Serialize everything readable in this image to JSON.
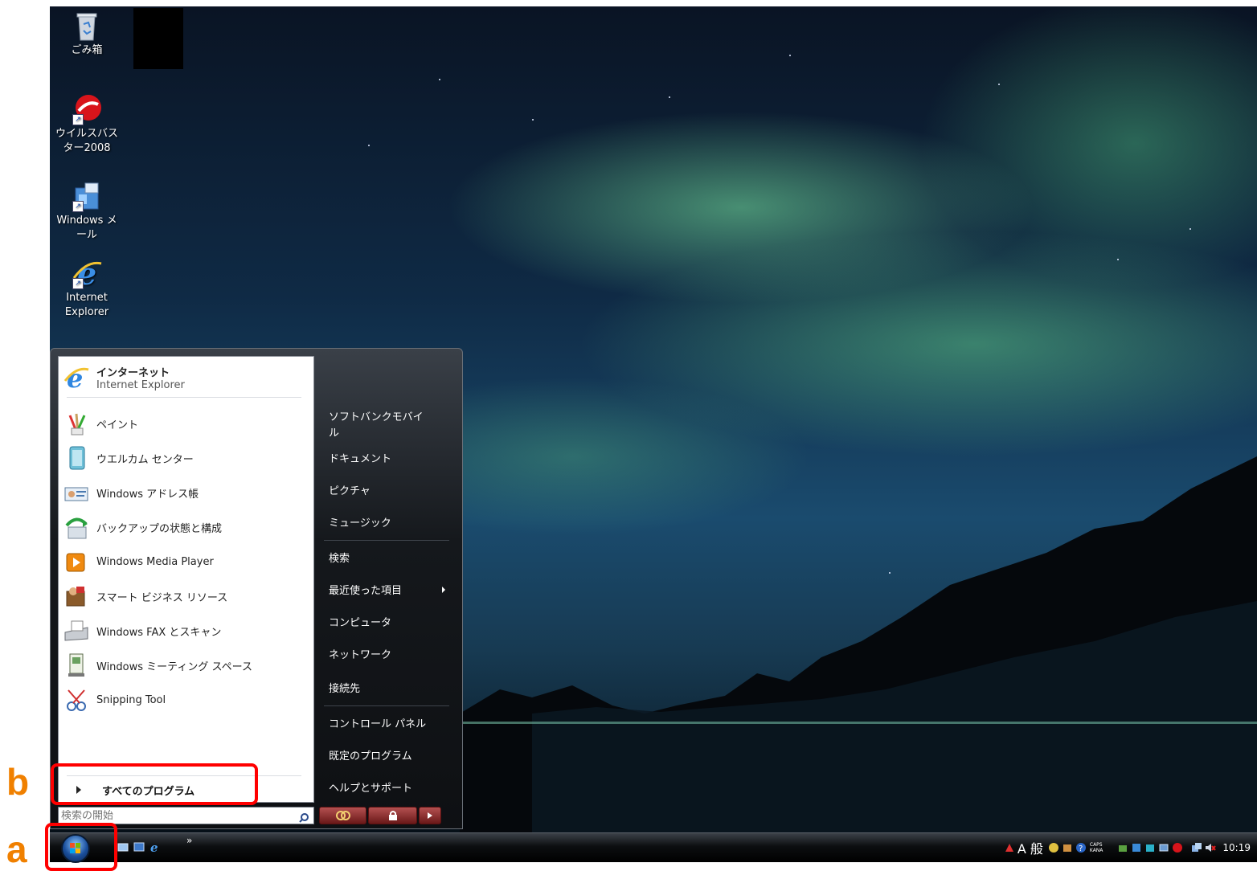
{
  "desktop": {
    "icons": [
      {
        "label": "ごみ箱",
        "icon": "recycle-bin-icon"
      },
      {
        "label": "ウイルスバス\nター2008",
        "icon": "virusbuster-icon"
      },
      {
        "label": "Windows メ\nール",
        "icon": "windows-mail-icon"
      },
      {
        "label": "Internet\nExplorer",
        "icon": "internet-explorer-icon"
      }
    ]
  },
  "start_menu": {
    "pinned": [
      {
        "title": "インターネット",
        "subtitle": "Internet Explorer",
        "icon": "internet-explorer-icon"
      }
    ],
    "recent": [
      {
        "label": "ペイント",
        "icon": "paint-icon"
      },
      {
        "label": "ウエルカム センター",
        "icon": "welcome-center-icon"
      },
      {
        "label": "Windows アドレス帳",
        "icon": "address-book-icon"
      },
      {
        "label": "バックアップの状態と構成",
        "icon": "backup-icon"
      },
      {
        "label": "Windows Media Player",
        "icon": "media-player-icon"
      },
      {
        "label": "スマート ビジネス リソース",
        "icon": "business-resource-icon"
      },
      {
        "label": "Windows FAX とスキャン",
        "icon": "fax-scan-icon"
      },
      {
        "label": "Windows ミーティング スペース",
        "icon": "meeting-space-icon"
      },
      {
        "label": "Snipping Tool",
        "icon": "snipping-tool-icon"
      }
    ],
    "all_programs": "すべてのプログラム",
    "search_placeholder": "検索の開始",
    "right": [
      {
        "label": "ソフトバンクモバイ\nル"
      },
      {
        "label": "ドキュメント"
      },
      {
        "label": "ピクチャ"
      },
      {
        "label": "ミュージック"
      },
      {
        "label": "検索"
      },
      {
        "label": "最近使った項目",
        "has_submenu": true
      },
      {
        "label": "コンピュータ"
      },
      {
        "label": "ネットワーク"
      },
      {
        "label": "接続先"
      },
      {
        "label": "コントロール パネル"
      },
      {
        "label": "既定のプログラム"
      },
      {
        "label": "ヘルプとサポート"
      }
    ]
  },
  "taskbar": {
    "quicklaunch_more": "»",
    "ime_text": "A 般",
    "caps_text": "CAPS\nKANA",
    "clock": "10:19"
  },
  "annotations": {
    "a": "a",
    "b": "b",
    "color": "#ff0000",
    "label_color": "#f08000"
  }
}
